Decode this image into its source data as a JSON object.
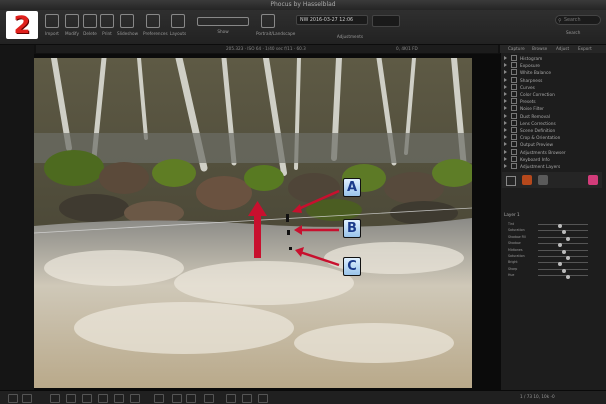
{
  "app": {
    "title": "Phocus by Hasselblad",
    "badge": "2"
  },
  "toolbar": {
    "items": [
      {
        "label": "Import",
        "icon": "import-icon"
      },
      {
        "label": "Modify",
        "icon": "modify-icon"
      },
      {
        "label": "Delete",
        "icon": "delete-icon"
      },
      {
        "label": "Print",
        "icon": "print-icon"
      },
      {
        "label": "Slideshow",
        "icon": "slideshow-icon"
      },
      {
        "label": "Preferences",
        "icon": "preferences-icon"
      },
      {
        "label": "Layouts",
        "icon": "layouts-icon"
      },
      {
        "label": "Show",
        "icon": "show-icon"
      },
      {
        "label": "Portrait/Landscape",
        "icon": "portrait-landscape-icon"
      },
      {
        "label": "Adjustments",
        "icon": "adjustments-icon"
      }
    ],
    "adjustment_dropdown": "NW 2016-03-27 12:06",
    "search_placeholder": "Search",
    "search_label": "Search"
  },
  "infobar": {
    "text": "205.323  ·  ISO 64  ·  1/40 sec  f/11  ·  60.3",
    "right": "0, 4K/1 FD"
  },
  "panel": {
    "tabs": [
      "Capture",
      "Browse",
      "Adjust",
      "Export"
    ],
    "tools": [
      "Histogram",
      "Exposure",
      "White Balance",
      "Sharpness",
      "Curves",
      "Color Correction",
      "Presets",
      "Noise Filter",
      "Dust Removal",
      "Lens Corrections",
      "Scene Definition",
      "Crop & Orientation",
      "Output Preview",
      "Adjustments Browser",
      "Keyboard Info",
      "Adjustment Layers"
    ],
    "layer_name": "Layer 1",
    "sliders": [
      "Tint",
      "Saturation",
      "Shadow Fill",
      "Shadow",
      "Midtones",
      "Saturation",
      "Bright",
      "Sharp",
      "Hue"
    ]
  },
  "annotations": {
    "a": "A",
    "b": "B",
    "c": "C"
  },
  "status": {
    "right": "1 / 73   10, 10k   -0"
  },
  "colors": {
    "arrow": "#c8102e",
    "badge_red": "#e0201c",
    "marker_bg": "#cfe6fb"
  }
}
